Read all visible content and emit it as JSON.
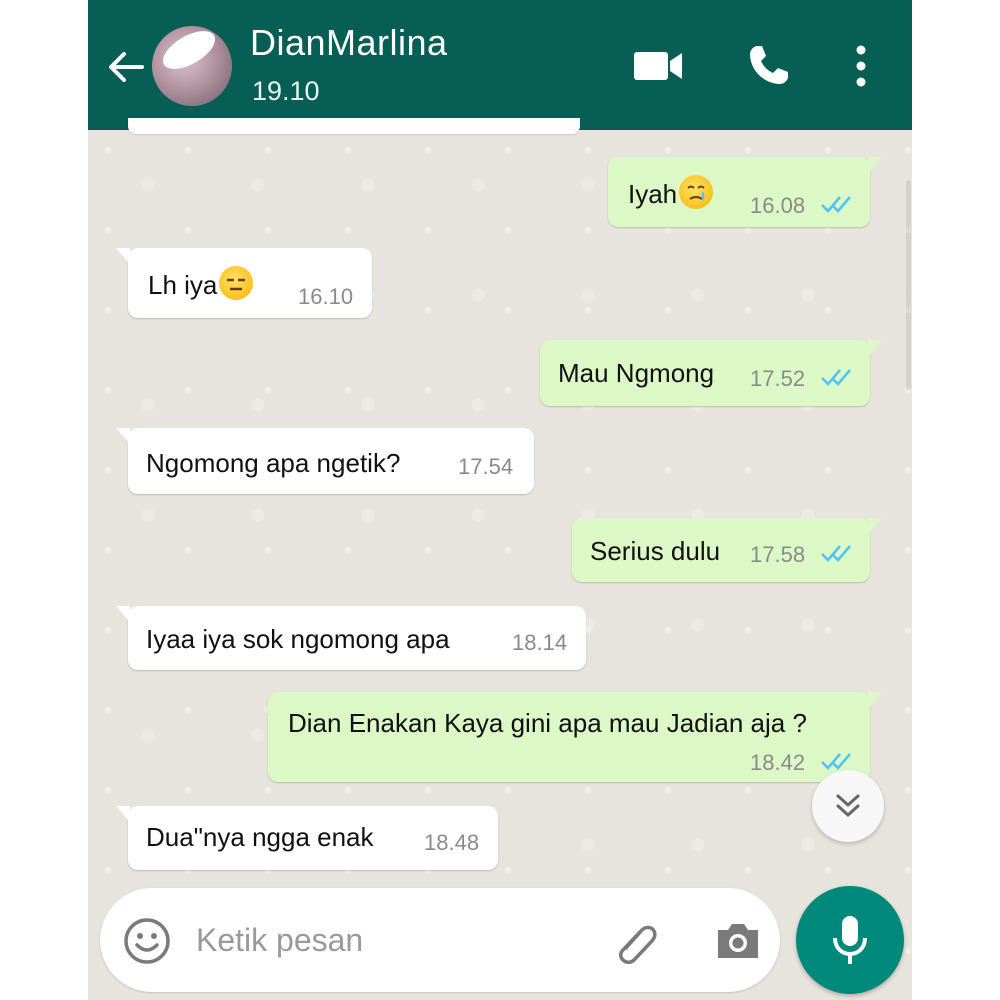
{
  "header": {
    "contact_name": "DianMarlina",
    "last_seen": "19.10",
    "icons": [
      "back-arrow-icon",
      "avatar",
      "video-call-icon",
      "voice-call-icon",
      "more-options-icon"
    ]
  },
  "messages": [
    {
      "direction": "out",
      "text": "Iyah",
      "emoji": "crying-face",
      "time": "16.08",
      "status": "read"
    },
    {
      "direction": "in",
      "text": "Lh iya",
      "emoji": "expressionless-face",
      "time": "16.10"
    },
    {
      "direction": "out",
      "text": "Mau Ngmong",
      "time": "17.52",
      "status": "read"
    },
    {
      "direction": "in",
      "text": "Ngomong apa ngetik?",
      "time": "17.54"
    },
    {
      "direction": "out",
      "text": "Serius dulu",
      "time": "17.58",
      "status": "read"
    },
    {
      "direction": "in",
      "text": "Iyaa iya sok ngomong apa",
      "time": "18.14"
    },
    {
      "direction": "out",
      "text": "Dian Enakan Kaya gini apa mau Jadian aja ?",
      "time": "18.42",
      "status": "read"
    },
    {
      "direction": "in",
      "text": "Dua\"nya ngga enak",
      "time": "18.48"
    }
  ],
  "composer": {
    "placeholder": "Ketik pesan",
    "icons": [
      "emoji-icon",
      "attach-icon",
      "camera-icon",
      "mic-icon"
    ]
  },
  "colors": {
    "header": "#075e54",
    "outgoing_bubble": "#dcf8c6",
    "incoming_bubble": "#ffffff",
    "read_ticks": "#4fc3f7",
    "mic_button": "#00897b"
  }
}
